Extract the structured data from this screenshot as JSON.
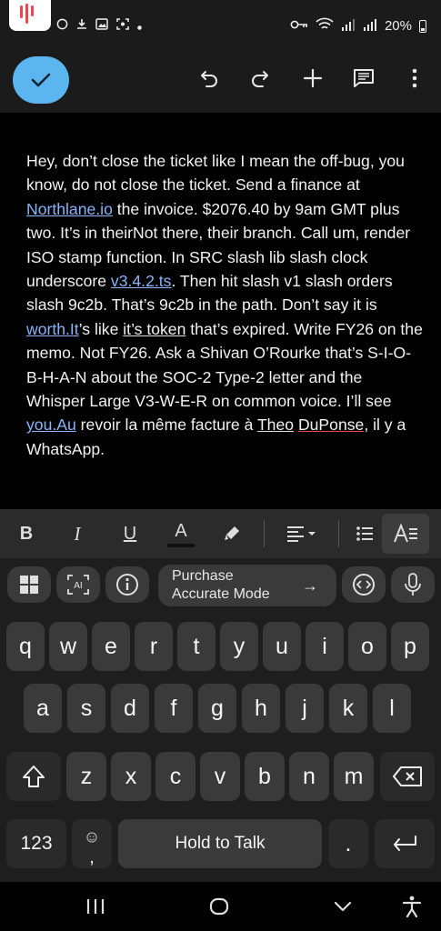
{
  "status_bar": {
    "battery": "20%",
    "icons": [
      "whatsapp-icon",
      "download-icon",
      "image-icon",
      "screenshot-icon",
      "dot-icon",
      "key-icon",
      "wifi-icon",
      "signal-icon",
      "signal-icon",
      "battery-icon"
    ]
  },
  "toolbar": {
    "done_icon": "check-icon",
    "icons": [
      "undo-icon",
      "redo-icon",
      "plus-icon",
      "comment-icon",
      "more-vert-icon"
    ]
  },
  "document": {
    "t1": "Hey, don’t close the ticket like I mean the off-bug, you know, do not close the ticket. Send a finance at ",
    "l1": "Northlane.io",
    "t2": " the invoice. $2076.40 by 9am GMT plus two. It’s in theirNot there, their branch. Call um, render ISO stamp function. In SRC slash lib slash clock underscore ",
    "l2": "v3.4.2.ts",
    "t3": ". Then hit slash v1 slash orders slash 9c2b. That’s 9c2b in the path. Don’t say it is ",
    "l3": "worth.It",
    "t4": "’s like ",
    "u1": "it’s token",
    "t5": " that’s expired. Write FY26 on the memo. Not FY26. Ask a Shivan O’Rourke that’s S-I-O-B-H-A-N about the SOC-2 Type-2 letter and the Whisper Large V3-W-E-R on common voice. I’ll see ",
    "l4": "you.Au",
    "t6": " revoir la même facture à ",
    "u2": "Theo",
    "t7": " ",
    "u3": "DuPonse",
    "t8": ", il y a WhatsApp."
  },
  "format_toolbar": {
    "bold": "B",
    "italic": "I",
    "underline": "U",
    "font_color": "A",
    "font_color_value": "#111111",
    "icons": [
      "highlighter-icon",
      "align-left-icon",
      "bulleted-list-icon",
      "text-format-icon"
    ]
  },
  "keyboard": {
    "suggestion_bar": {
      "left_icons": [
        "apps-grid-icon",
        "ai-icon",
        "info-icon"
      ],
      "center_line1": "Purchase",
      "center_line2": "Accurate Mode",
      "center_arrow": "→",
      "right_icons": [
        "code-icon",
        "mic-icon"
      ]
    },
    "rows": [
      [
        "q",
        "w",
        "e",
        "r",
        "t",
        "y",
        "u",
        "i",
        "o",
        "p"
      ],
      [
        "a",
        "s",
        "d",
        "f",
        "g",
        "h",
        "j",
        "k",
        "l"
      ],
      [
        "z",
        "x",
        "c",
        "v",
        "b",
        "n",
        "m"
      ]
    ],
    "shift_icon": "shift-icon",
    "backspace_icon": "backspace-icon",
    "numbers_label": "123",
    "comma_label": ",",
    "emoji_icon": "emoji-icon",
    "space_label": "Hold to Talk",
    "period_label": ".",
    "enter_icon": "enter-icon"
  },
  "nav_bar": {
    "icons": [
      "recent-apps-icon",
      "home-icon",
      "back-icon",
      "accessibility-icon"
    ]
  },
  "colors": {
    "accent": "#5bb6ef",
    "link": "#8ab4f8",
    "spell_error": "#e5484d",
    "background": "#000000",
    "keyboard": "#1e1e1e",
    "key": "#3a3a3a"
  }
}
